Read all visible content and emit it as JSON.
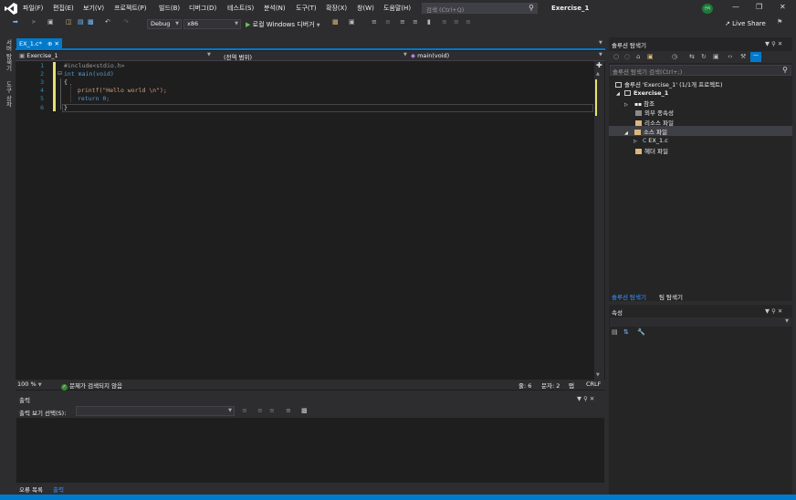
{
  "menubar": {
    "items": [
      "파일(F)",
      "편집(E)",
      "보기(V)",
      "프로젝트(P)",
      "빌드(B)",
      "디버그(D)",
      "테스트(S)",
      "분석(N)",
      "도구(T)",
      "확장(X)",
      "창(W)",
      "도움말(H)"
    ],
    "search_placeholder": "검색 (Ctrl+Q)",
    "solution_title": "Exercise_1",
    "avatar_text": "관리"
  },
  "toolbar": {
    "config": "Debug",
    "platform": "x86",
    "run_label": "로컬 Windows 디버거",
    "live_share": "Live Share"
  },
  "left_strip": {
    "server_explorer": "서버 탐색기",
    "toolbox": "도구 상자"
  },
  "editor": {
    "tab_label": "EX_1.c*",
    "nav": {
      "project": "Exercise_1",
      "scope": "(전역 범위)",
      "member": "main(void)"
    },
    "lines": [
      {
        "num": "1",
        "text": "#include<stdio.h>"
      },
      {
        "num": "2",
        "text": "int main(void)"
      },
      {
        "num": "3",
        "text": "{"
      },
      {
        "num": "4",
        "text": "printf(\"Hello world \\n\");"
      },
      {
        "num": "5",
        "text": "return 0;"
      },
      {
        "num": "6",
        "text": "}"
      }
    ],
    "status": {
      "zoom": "100 %",
      "issues": "문제가 검색되지 않음",
      "line": "줄: 6",
      "col": "문자: 2",
      "tab": "탭",
      "eol": "CRLF"
    }
  },
  "output": {
    "title": "출력",
    "show_from_label": "출력 보기 선택(S):"
  },
  "bottom_tabs": [
    "오류 목록",
    "출력"
  ],
  "solution_explorer": {
    "title": "솔루션 탐색기",
    "search_placeholder": "솔루션 탐색기 검색(Ctrl+;)",
    "tree": [
      {
        "label": "솔루션 'Exercise_1' (1/1개 프로젝트)",
        "level": 0
      },
      {
        "label": "Exercise_1",
        "level": 1
      },
      {
        "label": "참조",
        "level": 2
      },
      {
        "label": "외부 종속성",
        "level": 2
      },
      {
        "label": "리소스 파일",
        "level": 2
      },
      {
        "label": "소스 파일",
        "level": 2
      },
      {
        "label": "EX_1.c",
        "level": 3
      },
      {
        "label": "헤더 파일",
        "level": 2
      }
    ],
    "tabs": [
      "솔루션 탐색기",
      "팀 탐색기"
    ]
  },
  "properties": {
    "title": "속성"
  }
}
